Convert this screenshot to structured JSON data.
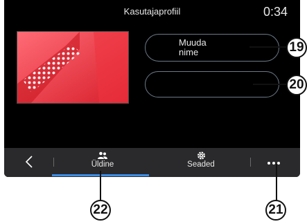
{
  "header": {
    "title": "Kasutajaprofiil",
    "clock": "0:34"
  },
  "profile": {
    "rename_label": "Muuda\nnime",
    "second_button_label": ""
  },
  "navbar": {
    "back_icon": "chevron-left-icon",
    "tabs": [
      {
        "label": "Üldine",
        "icon": "users-icon",
        "active": true
      },
      {
        "label": "Seaded",
        "icon": "gear-icon",
        "active": false
      }
    ],
    "more_icon": "more-dots-icon"
  },
  "callouts": [
    "19",
    "20",
    "21",
    "22"
  ],
  "colors": {
    "screen_bg": "#000000",
    "navbar_bg": "#2a2a2c",
    "active_tab": "#3c8ee8",
    "pill_border": "#6d7a88"
  }
}
